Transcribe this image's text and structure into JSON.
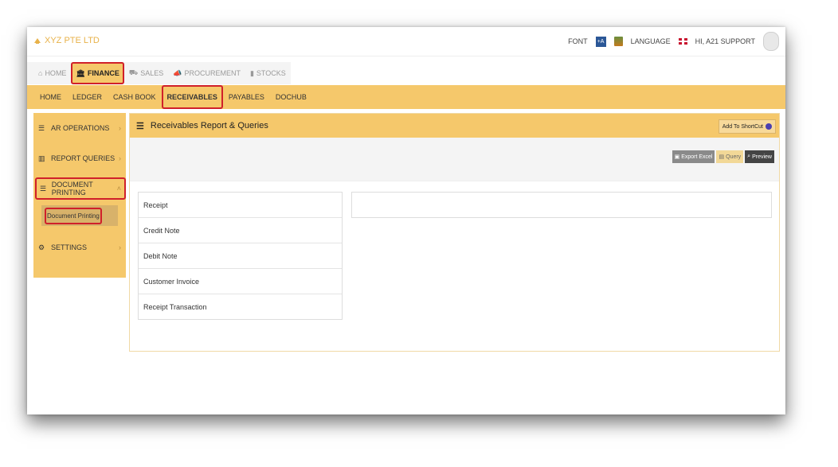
{
  "brand": {
    "name": "XYZ PTE LTD",
    "color": "#e8b24a"
  },
  "topbar": {
    "font_label": "FONT",
    "language_label": "LANGUAGE",
    "greeting": "HI, A21 SUPPORT"
  },
  "modules": [
    {
      "label": "HOME",
      "icon": "home-icon",
      "active": false
    },
    {
      "label": "FINANCE",
      "icon": "bank-icon",
      "active": true
    },
    {
      "label": "SALES",
      "icon": "cart-icon",
      "active": false
    },
    {
      "label": "PROCUREMENT",
      "icon": "megaphone-icon",
      "active": false
    },
    {
      "label": "STOCKS",
      "icon": "bar-chart-icon",
      "active": false
    }
  ],
  "subnav": [
    {
      "label": "HOME"
    },
    {
      "label": "LEDGER"
    },
    {
      "label": "CASH BOOK"
    },
    {
      "label": "RECEIVABLES",
      "active": true
    },
    {
      "label": "PAYABLES"
    },
    {
      "label": "DOCHUB"
    }
  ],
  "sidebar": {
    "items": [
      {
        "label": "AR OPERATIONS",
        "icon": "list-icon"
      },
      {
        "label": "REPORT QUERIES",
        "icon": "bar-chart-icon"
      },
      {
        "label": "DOCUMENT PRINTING",
        "icon": "list-icon",
        "expanded": true
      },
      {
        "label": "SETTINGS",
        "icon": "gear-icon"
      }
    ],
    "sub_item": "Document Printing"
  },
  "panel": {
    "title": "Receivables Report & Queries",
    "shortcut": "Add To ShortCut",
    "buttons": {
      "export": "Export Excel",
      "query": "Query",
      "preview": "Preview"
    },
    "documents": [
      "Receipt",
      "Credit Note",
      "Debit Note",
      "Customer Invoice",
      "Receipt Transaction"
    ]
  },
  "colors": {
    "accent": "#f5c86b",
    "highlight": "#d0202a"
  }
}
